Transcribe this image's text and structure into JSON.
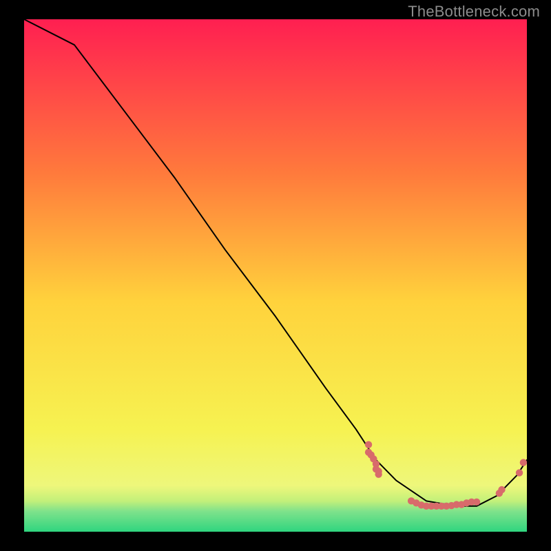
{
  "watermark": "TheBottleneck.com",
  "chart_data": {
    "type": "line",
    "title": "",
    "xlabel": "",
    "ylabel": "",
    "xlim": [
      0,
      100
    ],
    "ylim": [
      0,
      100
    ],
    "grid": false,
    "series": [
      {
        "name": "curve",
        "x": [
          0,
          6,
          10,
          20,
          30,
          40,
          50,
          60,
          66,
          70,
          74,
          80,
          86,
          90,
          94,
          98,
          100
        ],
        "values": [
          100,
          97,
          95,
          82,
          69,
          55,
          42,
          28,
          20,
          14,
          10,
          6,
          5,
          5,
          7,
          11,
          14
        ],
        "color": "#000000"
      },
      {
        "name": "points-left-cluster",
        "type": "scatter",
        "x": [
          68.5,
          68.5,
          69.0,
          69.5,
          70.0,
          70.0,
          70.5,
          70.5
        ],
        "values": [
          17.0,
          15.5,
          15.0,
          14.2,
          13.2,
          12.2,
          11.8,
          11.2
        ],
        "color": "#d86b6b"
      },
      {
        "name": "points-bottom-scatter",
        "type": "scatter",
        "x": [
          77,
          78,
          79,
          80,
          81,
          82,
          83,
          84,
          85,
          86,
          87,
          88,
          89,
          90
        ],
        "values": [
          6,
          5.6,
          5.2,
          5,
          5,
          5,
          5,
          5,
          5.1,
          5.3,
          5.3,
          5.6,
          5.8,
          5.8
        ],
        "color": "#d86b6b"
      },
      {
        "name": "points-right-cluster",
        "type": "scatter",
        "x": [
          94.5,
          95.0,
          98.5,
          99.3
        ],
        "values": [
          7.5,
          8.2,
          11.5,
          13.5
        ],
        "color": "#d86b6b"
      }
    ],
    "background_gradient": {
      "direction": "vertical",
      "stops": [
        {
          "y": 0,
          "color": "#ff1f51"
        },
        {
          "y": 30,
          "color": "#ff7a3c"
        },
        {
          "y": 55,
          "color": "#ffd23c"
        },
        {
          "y": 80,
          "color": "#f6f251"
        },
        {
          "y": 91,
          "color": "#eef77b"
        },
        {
          "y": 94,
          "color": "#c3f07a"
        },
        {
          "y": 96,
          "color": "#7fe28b"
        },
        {
          "y": 100,
          "color": "#2fd57f"
        }
      ]
    }
  }
}
